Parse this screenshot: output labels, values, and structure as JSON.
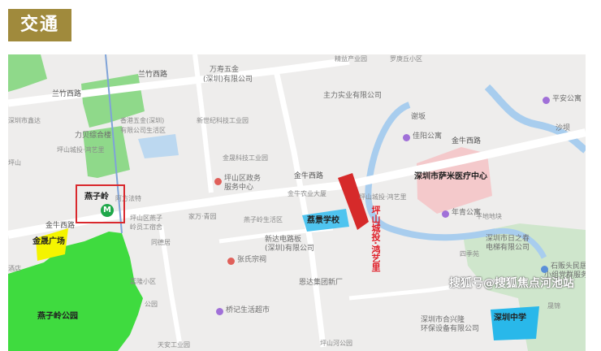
{
  "section_title": "交通",
  "colors": {
    "section_bg": "#a08a3c",
    "project_marker": "#d62a2a",
    "metro": "#1fa84a",
    "park": "#4ad64a",
    "school": "#4fc4ef",
    "mall": "#f4f400",
    "hospital": "#f4c9cb",
    "metro_highlight_box": "#d9282d"
  },
  "map": {
    "roads": {
      "road_1": "兰竹西路",
      "road_2": "兰竹西路",
      "road_3": "金牛西路",
      "road_4": "金牛西路",
      "road_5": "金牛西路"
    },
    "highlight": {
      "metro_station": "燕子岭",
      "metro_icon": "M",
      "mall": "金晟广场",
      "park": "燕子岭公园",
      "school_1": "荔景学校",
      "school_2": "深圳中学",
      "hospital": "深圳市萨米医疗中心",
      "project": "坪山城投·鸿艺里"
    },
    "labels": {
      "l01": "精益产业园",
      "l02": "罗庚丘小区",
      "l03": "万寿五金",
      "l04": "(深圳)有限公司",
      "l05": "主力实业有限公司",
      "l06": "平安公寓",
      "l07": "谢坂",
      "l08": "佳阳公寓",
      "l09": "沙坝",
      "l10": "力贝综合楼",
      "l11": "香港五金(深圳)",
      "l12": "有限公司生活区",
      "l13": "新世纪科技工业园",
      "l14": "金晟科技工业园",
      "l15": "坪山区政务",
      "l16": "服务中心",
      "l17": "阿方法特",
      "l18": "坪山区燕子",
      "l19": "岭员工宿舍",
      "l20": "同德居",
      "l21": "家万·青园",
      "l22": "燕子岭生活区",
      "l23": "新达电路板",
      "l24": "(深圳)有限公司",
      "l25": "张氏宗祠",
      "l26": "金牛农业大厦",
      "l27": "坪山城投·鸿艺里",
      "l28": "年青公寓",
      "l29": "深圳市日之春",
      "l30": "电梯有限公司",
      "l31": "四季苑",
      "l32": "石贩头民居",
      "l33": "小组党群服务",
      "l34": "嘉隆小区",
      "l35": "恩达集团新厂",
      "l36": "桥记生活超市",
      "l37": "深圳市合兴隆",
      "l38": "环保设备有限公司",
      "l39": "天安工业园",
      "l40": "坪山河公园",
      "l41": "坪山",
      "l42": "深圳市鑫达",
      "l43": "酒店",
      "l44": "公园",
      "l45": "晟锦",
      "l46": "平地地块",
      "l47": "坪山城投·鸿艺里"
    }
  },
  "watermark": "搜狐号@搜狐焦点河池站"
}
